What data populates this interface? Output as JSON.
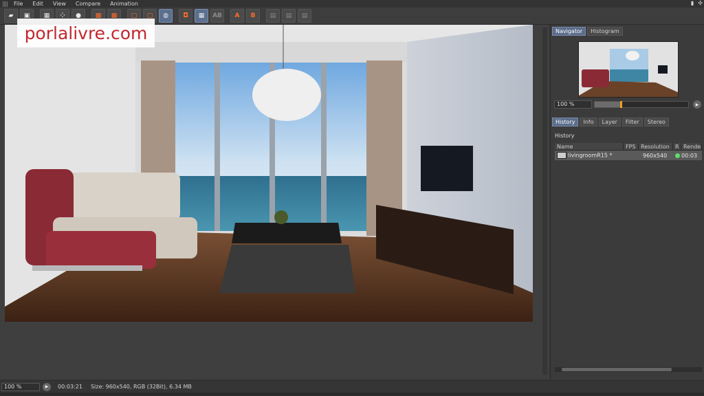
{
  "menu": [
    "File",
    "Edit",
    "View",
    "Compare",
    "Animation"
  ],
  "toolbar_icons": [
    "open-icon",
    "save-icon",
    "grid-icon",
    "dots-icon",
    "camera-icon",
    "region-render-icon",
    "render-icon",
    "compare-icon",
    "compare-split-icon",
    "compare-overlay-icon",
    "ab-icon",
    "ab-toggle-icon",
    "ab-disabled-icon",
    "set-a-icon",
    "set-b-icon",
    "channel-r-icon",
    "channel-g-icon",
    "channel-b-icon"
  ],
  "toolbar_text": {
    "ab": "AB",
    "a": "A",
    "b": "B"
  },
  "watermark": "porlalivre.com",
  "navigator": {
    "tabs": [
      "Navigator",
      "Histogram"
    ],
    "active_tab": "Navigator",
    "zoom": "100 %",
    "zoom_fraction": 0.27
  },
  "history_panel": {
    "tabs": [
      "History",
      "Info",
      "Layer",
      "Filter",
      "Stereo"
    ],
    "active_tab": "History",
    "title": "History",
    "columns": [
      "Name",
      "FPS",
      "Resolution",
      "R",
      "Rende"
    ],
    "rows": [
      {
        "name": "livingroomR15 *",
        "fps": "",
        "resolution": "960x540",
        "status": "green",
        "render_time": "00:03"
      }
    ]
  },
  "status_bar": {
    "zoom": "100 %",
    "time": "00:03:21",
    "info": "Size: 960x540, RGB (32Bit), 6.34 MB"
  },
  "colors": {
    "accent": "#5c6d8a",
    "watermark_text": "#c2262e",
    "status_green": "#5be06a",
    "slider_thumb": "#f0a020"
  }
}
